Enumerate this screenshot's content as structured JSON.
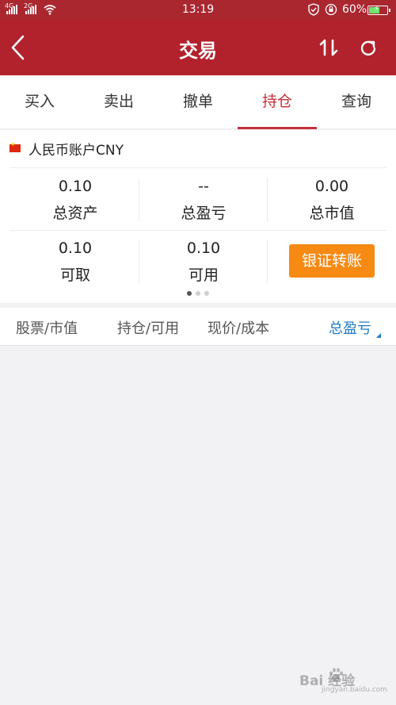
{
  "status_bar": {
    "sim1": "4G",
    "sim2": "2G",
    "time": "13:19",
    "battery_percent": "60%",
    "battery_level": 0.6
  },
  "header": {
    "title": "交易"
  },
  "tabs": [
    {
      "label": "买入"
    },
    {
      "label": "卖出"
    },
    {
      "label": "撤单"
    },
    {
      "label": "持仓",
      "active": true
    },
    {
      "label": "查询"
    }
  ],
  "account": {
    "name": "人民币账户CNY",
    "metrics": [
      {
        "value": "0.10",
        "label": "总资产"
      },
      {
        "value": "--",
        "label": "总盈亏"
      },
      {
        "value": "0.00",
        "label": "总市值"
      },
      {
        "value": "0.10",
        "label": "可取"
      },
      {
        "value": "0.10",
        "label": "可用"
      }
    ],
    "transfer_button": "银证转账",
    "page_count": 3,
    "current_page": 1
  },
  "list_header": {
    "col1": "股票/市值",
    "col2": "持仓/可用",
    "col3": "现价/成本",
    "col4": "总盈亏"
  },
  "watermark": {
    "text": "Bai 经验",
    "url": "jingyan.baidu.com"
  },
  "colors": {
    "header_red": "#b2222c",
    "active_tab": "#c4303a",
    "transfer_orange": "#f68a13",
    "sort_blue": "#1e7bc6"
  }
}
